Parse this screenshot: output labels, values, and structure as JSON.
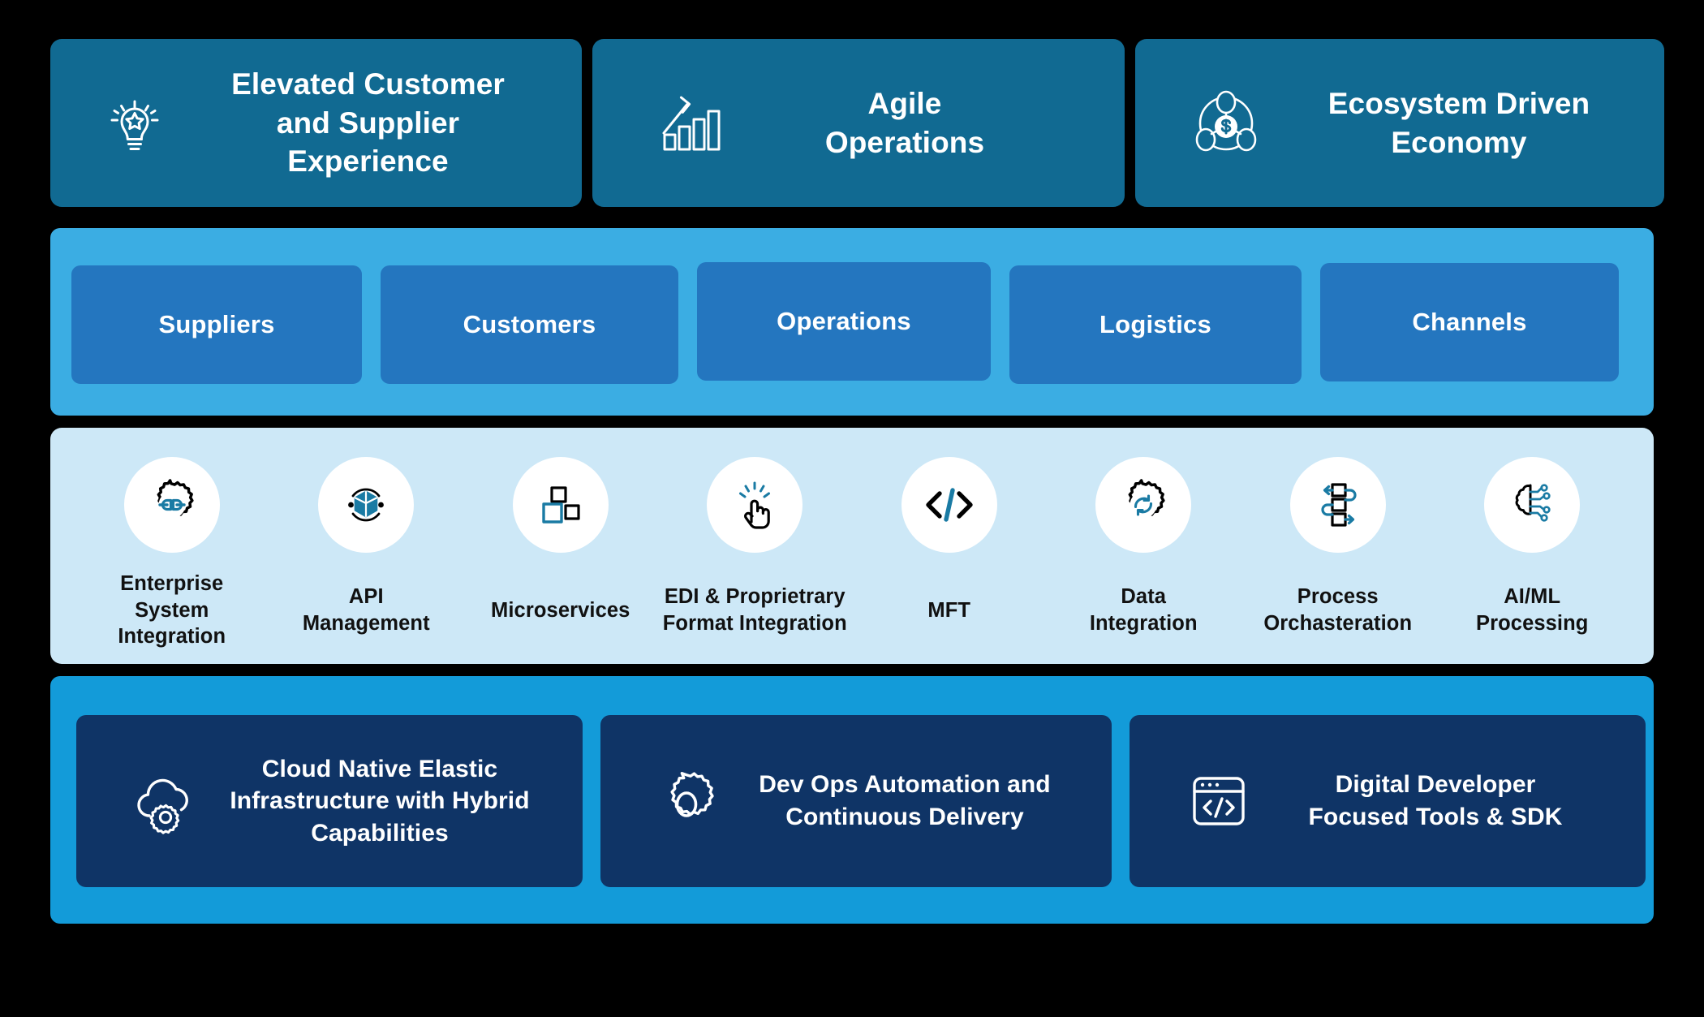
{
  "colors": {
    "background": "#000000",
    "pillar_card": "#116A92",
    "audience_band": "#3BADE3",
    "audience_chip": "#2476BF",
    "capability_band": "#CDE8F7",
    "capability_circle": "#FFFFFF",
    "foundation_band": "#139BD9",
    "foundation_card": "#0F3466",
    "icon_accent": "#1A7BA4",
    "icon_dark": "#000000",
    "text_light": "#FFFFFF",
    "text_dark": "#111111"
  },
  "outcomes": {
    "items": [
      {
        "label": "Elevated Customer\nand Supplier Experience",
        "icon": "lightbulb-star-icon"
      },
      {
        "label": "Agile\nOperations",
        "icon": "growth-bar-chart-icon"
      },
      {
        "label": "Ecosystem Driven\nEconomy",
        "icon": "ecosystem-dollar-network-icon"
      }
    ]
  },
  "audiences": {
    "items": [
      {
        "label": "Suppliers"
      },
      {
        "label": "Customers"
      },
      {
        "label": "Operations"
      },
      {
        "label": "Logistics"
      },
      {
        "label": "Channels"
      }
    ]
  },
  "capabilities": {
    "items": [
      {
        "label": "Enterprise\nSystem\nIntegration",
        "icon": "gear-plug-icon"
      },
      {
        "label": "API\nManagement",
        "icon": "cube-orbit-icon"
      },
      {
        "label": "Microservices",
        "icon": "squares-blocks-icon"
      },
      {
        "label": "EDI & Proprietrary\nFormat Integration",
        "icon": "click-hand-icon"
      },
      {
        "label": "MFT",
        "icon": "code-brackets-icon"
      },
      {
        "label": "Data\nIntegration",
        "icon": "gear-refresh-icon"
      },
      {
        "label": "Process\nOrchasteration",
        "icon": "workflow-arrows-icon"
      },
      {
        "label": "AI/ML\nProcessing",
        "icon": "brain-circuit-icon"
      }
    ]
  },
  "foundation": {
    "items": [
      {
        "label": "Cloud Native Elastic\nInfrastructure with Hybrid\nCapabilities",
        "icon": "cloud-gear-icon"
      },
      {
        "label": "Dev Ops Automation and\nContinuous Delivery",
        "icon": "gear-outline-icon"
      },
      {
        "label": "Digital Developer\nFocused Tools & SDK",
        "icon": "browser-code-icon"
      }
    ]
  }
}
